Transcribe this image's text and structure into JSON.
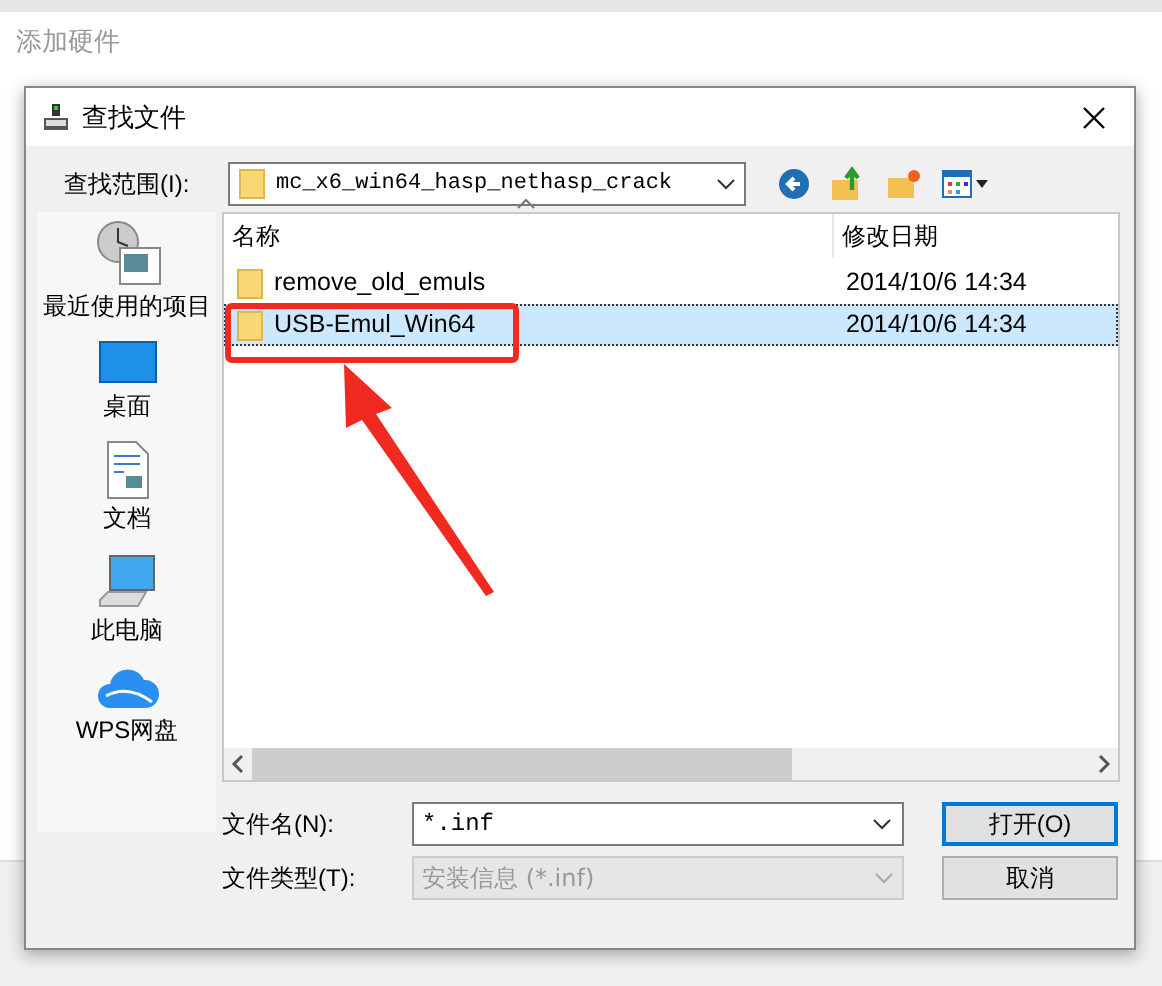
{
  "parent_window": {
    "title": "添加硬件"
  },
  "dialog": {
    "title": "查找文件",
    "look_in": {
      "label": "查找范围(I):",
      "value": "mc_x6_win64_hasp_nethasp_crack"
    },
    "places": [
      {
        "label": "最近使用的项目",
        "kind": "recent"
      },
      {
        "label": "桌面",
        "kind": "desktop"
      },
      {
        "label": "文档",
        "kind": "documents"
      },
      {
        "label": "此电脑",
        "kind": "computer"
      },
      {
        "label": "WPS网盘",
        "kind": "cloud"
      }
    ],
    "columns": [
      {
        "label": "名称",
        "sorted": true
      },
      {
        "label": "修改日期",
        "sorted": false
      }
    ],
    "files": [
      {
        "name": "remove_old_emuls",
        "modified": "2014/10/6 14:34",
        "selected": false
      },
      {
        "name": "USB-Emul_Win64",
        "modified": "2014/10/6 14:34",
        "selected": true
      }
    ],
    "file_name": {
      "label": "文件名(N):",
      "value": "*.inf"
    },
    "file_type": {
      "label": "文件类型(T):",
      "value": "安装信息 (*.inf)",
      "disabled": true
    },
    "buttons": [
      {
        "label": "打开(O)",
        "default": true
      },
      {
        "label": "取消",
        "default": false
      }
    ]
  }
}
